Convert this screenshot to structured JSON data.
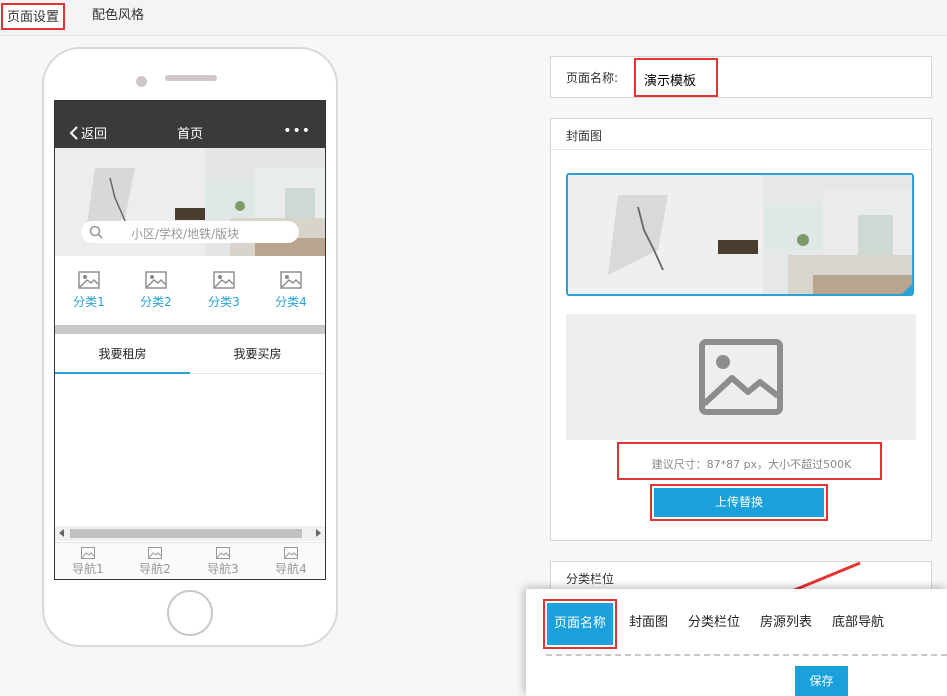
{
  "top_tabs": {
    "page_settings": "页面设置",
    "color_style": "配色风格"
  },
  "phone": {
    "back_label": "返回",
    "title": "首页",
    "more": "•••",
    "search_placeholder": "小区/学校/地铁/版块",
    "categories": [
      "分类1",
      "分类2",
      "分类3",
      "分类4"
    ],
    "tabs": [
      "我要租房",
      "我要买房"
    ],
    "bottom_nav": [
      "导航1",
      "导航2",
      "导航3",
      "导航4"
    ]
  },
  "page_name": {
    "label": "页面名称:",
    "value": "演示模板"
  },
  "cover": {
    "header": "封面图",
    "hint": "建议尺寸：87*87 px，大小不超过500K",
    "upload_label": "上传替换"
  },
  "category_panel": {
    "header": "分类栏位"
  },
  "popup": {
    "tabs": [
      "页面名称",
      "封面图",
      "分类栏位",
      "房源列表",
      "底部导航"
    ],
    "save_label": "保存"
  },
  "colors": {
    "accent": "#1aa0db",
    "highlight": "#e53333",
    "header_bg": "#3a3a3c"
  }
}
